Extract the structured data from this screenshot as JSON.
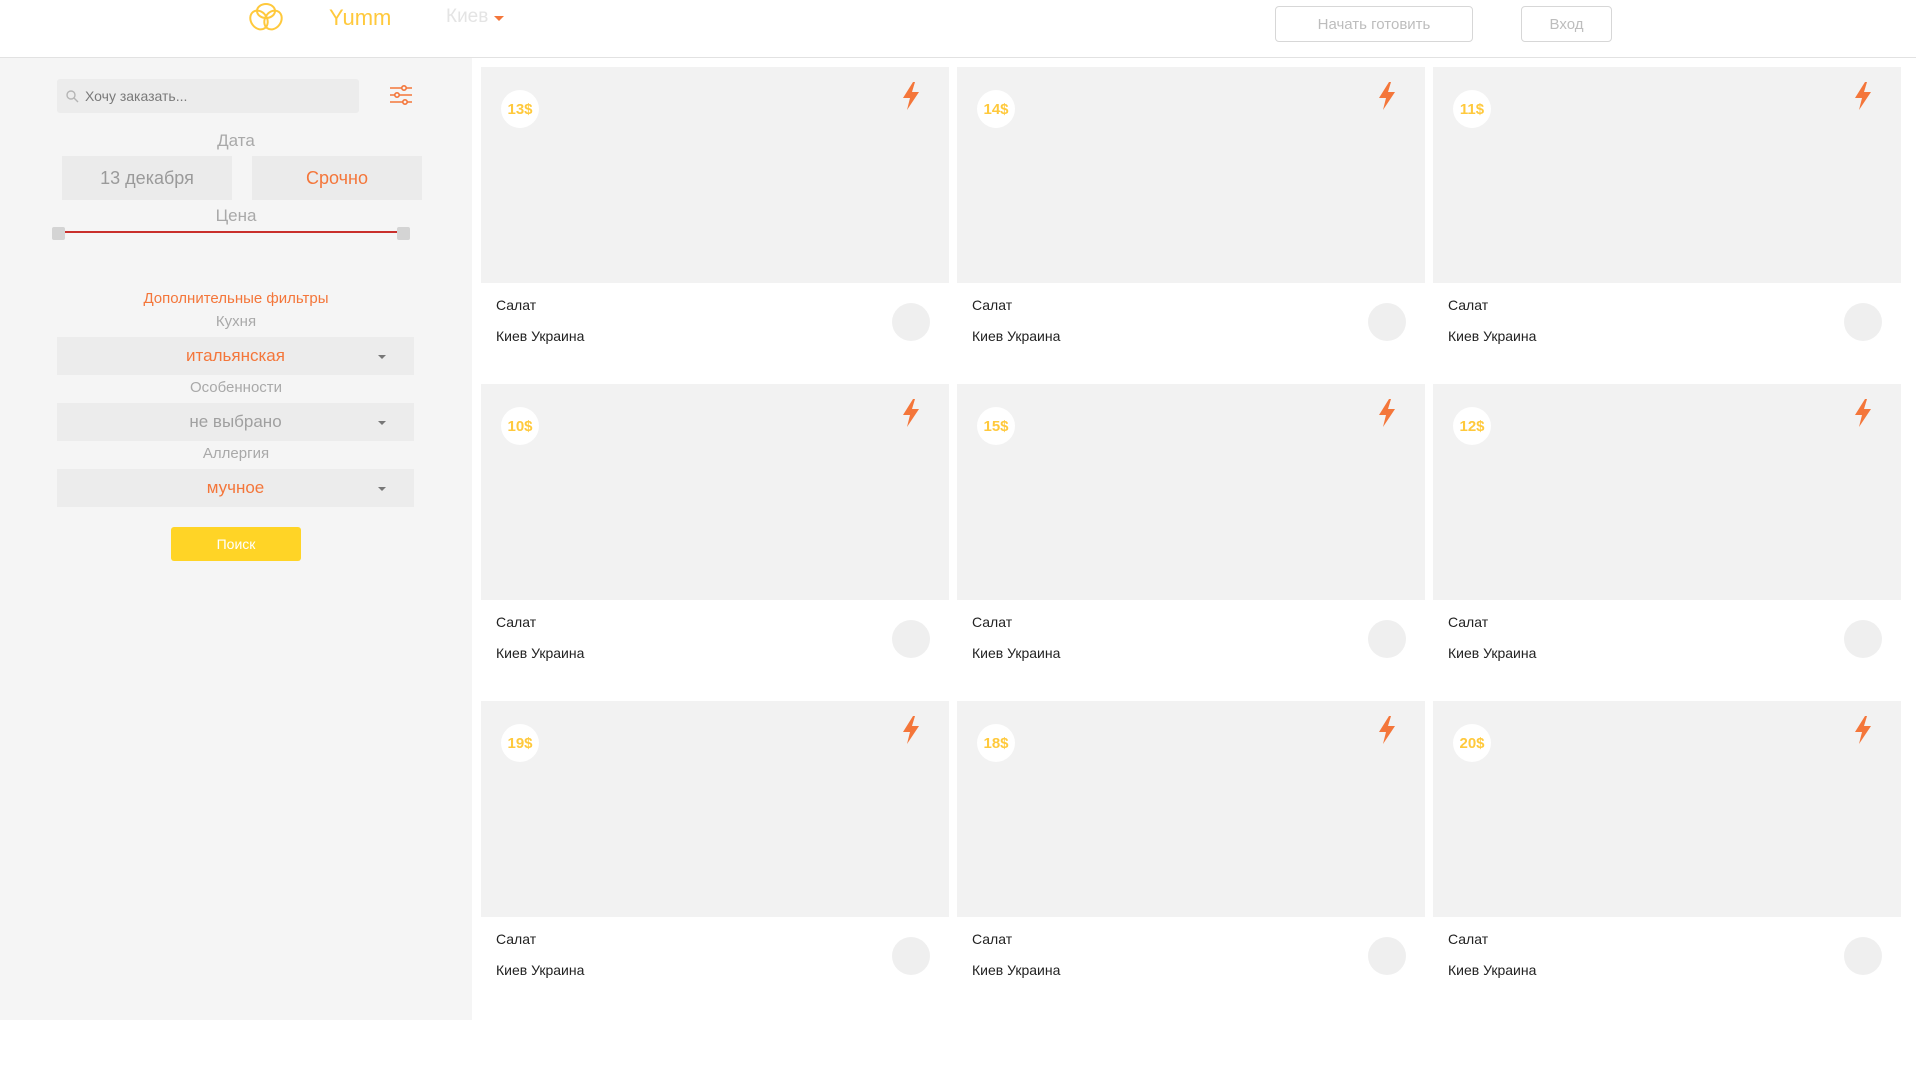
{
  "header": {
    "brand": "Yumm",
    "city": "Киев",
    "start_cooking": "Начать готовить",
    "login": "Вход"
  },
  "sidebar": {
    "search_placeholder": "Хочу заказать...",
    "date_label": "Дата",
    "date_value": "13 декабря",
    "urgent_label": "Срочно",
    "price_label": "Цена",
    "extra_filters": "Дополнительные фильтры",
    "cuisine_label": "Кухня",
    "cuisine_value": "итальянская",
    "features_label": "Особенности",
    "features_value": "не выбрано",
    "allergy_label": "Аллергия",
    "allergy_value": "мучное",
    "search_button": "Поиск"
  },
  "cards": [
    {
      "price": "13$",
      "title": "Салат",
      "location": "Киев Украина"
    },
    {
      "price": "14$",
      "title": "Салат",
      "location": "Киев Украина"
    },
    {
      "price": "11$",
      "title": "Салат",
      "location": "Киев Украина"
    },
    {
      "price": "10$",
      "title": "Салат",
      "location": "Киев Украина"
    },
    {
      "price": "15$",
      "title": "Салат",
      "location": "Киев Украина"
    },
    {
      "price": "12$",
      "title": "Салат",
      "location": "Киев Украина"
    },
    {
      "price": "19$",
      "title": "Салат",
      "location": "Киев Украина"
    },
    {
      "price": "18$",
      "title": "Салат",
      "location": "Киев Украина"
    },
    {
      "price": "20$",
      "title": "Салат",
      "location": "Киев Украина"
    }
  ],
  "colors": {
    "brand_yellow": "#ffc93c",
    "accent_orange": "#f4763a",
    "button_yellow": "#ffd426",
    "slider_red": "#c9302c"
  }
}
